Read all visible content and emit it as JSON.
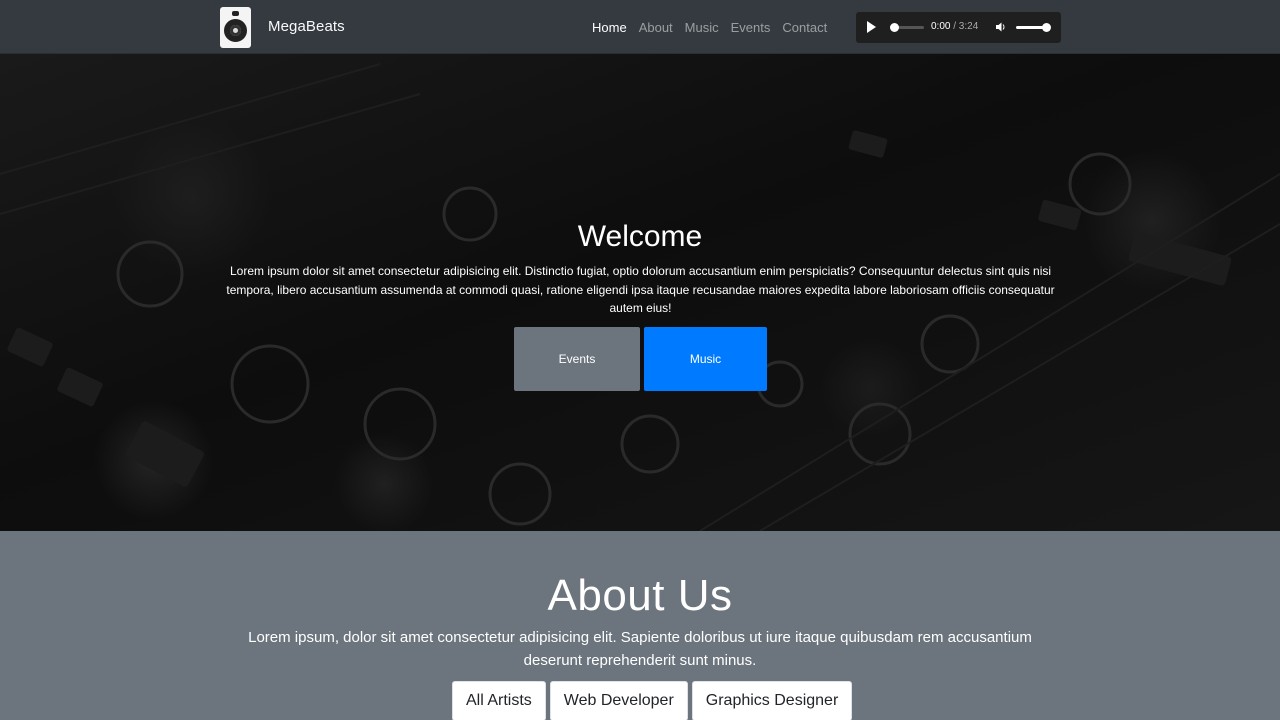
{
  "brand": {
    "name": "MegaBeats",
    "logo_icon": "speaker-icon"
  },
  "nav": {
    "items": [
      {
        "label": "Home",
        "active": true
      },
      {
        "label": "About",
        "active": false
      },
      {
        "label": "Music",
        "active": false
      },
      {
        "label": "Events",
        "active": false
      },
      {
        "label": "Contact",
        "active": false
      }
    ]
  },
  "audio": {
    "current_time": "0:00",
    "duration": "/ 3:24",
    "progress": 0,
    "volume": 1.0,
    "play_icon": "play-icon",
    "volume_icon": "volume-icon"
  },
  "hero": {
    "title": "Welcome",
    "text": "Lorem ipsum dolor sit amet consectetur adipisicing elit. Distinctio fugiat, optio dolorum accusantium enim perspiciatis? Consequuntur delectus sint quis nisi tempora, libero accusantium assumenda at commodi quasi, ratione eligendi ipsa itaque recusandae maiores expedita labore laboriosam officiis consequatur autem eius!",
    "buttons": {
      "events": "Events",
      "music": "Music"
    }
  },
  "about": {
    "title": "About Us",
    "text": "Lorem ipsum, dolor sit amet consectetur adipisicing elit. Sapiente doloribus ut iure itaque quibusdam rem accusantium deserunt reprehenderit sunt minus.",
    "filters": [
      "All Artists",
      "Web Developer",
      "Graphics Designer"
    ]
  },
  "colors": {
    "navbar": "#343a40",
    "section_gray": "#6c757d",
    "primary": "#007bff"
  }
}
